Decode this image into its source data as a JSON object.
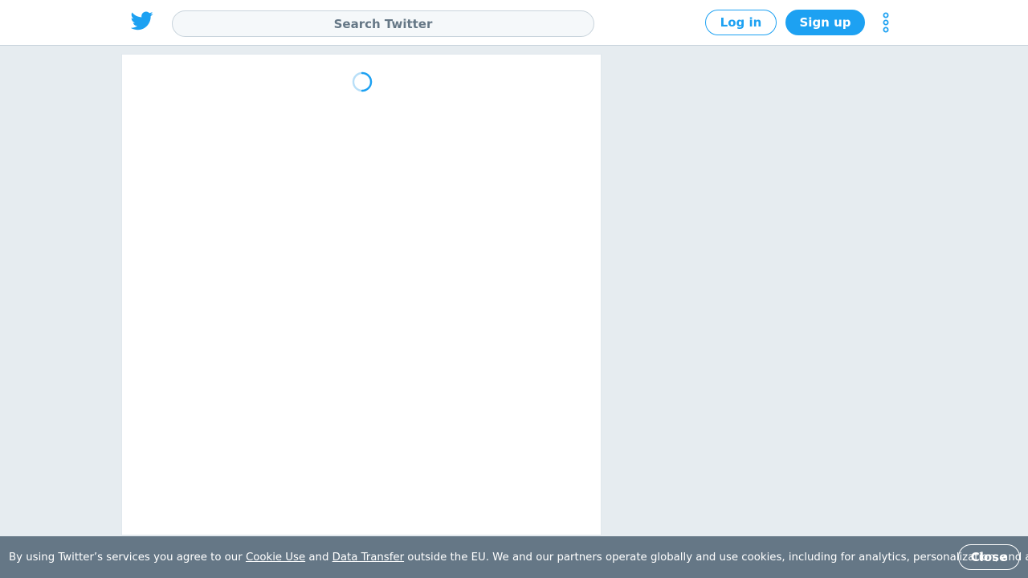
{
  "header": {
    "search_placeholder": "Search Twitter",
    "login_label": "Log in",
    "signup_label": "Sign up"
  },
  "icons": {
    "logo": "twitter-bird-icon",
    "more": "more-vertical-icon",
    "loading": "loading-spinner-icon"
  },
  "cookie_banner": {
    "text_before": "By using Twitter’s services you agree to our ",
    "cookie_link": "Cookie Use",
    "text_and": " and ",
    "transfer_link": "Data Transfer",
    "text_after": " outside the EU. We and our partners operate globally and use cookies, including for analytics, personalization, and ads.",
    "close_label": "Close"
  },
  "colors": {
    "brand": "#1da1f2",
    "page_background": "#e6ecf0",
    "banner_background": "#657786"
  }
}
